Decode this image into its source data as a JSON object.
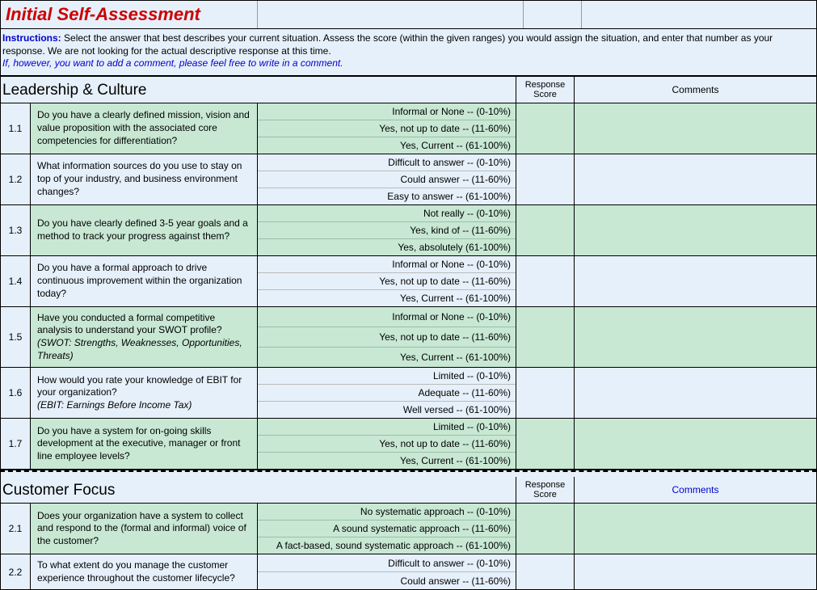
{
  "title": "Initial Self-Assessment",
  "instructions": {
    "lead": "Instructions:",
    "body": "Select the answer that best describes your current situation.  Assess the score (within the given ranges) you would assign the situation, and enter that number as your response.  We are not looking for the actual descriptive response at this time.",
    "comment_note": "If, however, you want to add a comment, please feel free to write in a comment."
  },
  "columns": {
    "score": "Response Score",
    "comments": "Comments"
  },
  "sections": [
    {
      "title": "Leadership & Culture",
      "comments_link": false,
      "questions": [
        {
          "num": "1.1",
          "text": "Do you have a clearly defined mission, vision and value proposition with the associated core competencies for differentiation?",
          "hint": "",
          "options": [
            "Informal or None -- (0-10%)",
            "Yes, not up to date -- (11-60%)",
            "Yes, Current -- (61-100%)"
          ],
          "shade": true
        },
        {
          "num": "1.2",
          "text": "What information sources do you use to stay on top of your industry, and business environment changes?",
          "hint": "",
          "options": [
            "Difficult to answer -- (0-10%)",
            "Could answer -- (11-60%)",
            "Easy to answer -- (61-100%)"
          ],
          "shade": false
        },
        {
          "num": "1.3",
          "text": "Do you have clearly defined 3-5 year goals and a method to track your progress against them?",
          "hint": "",
          "options": [
            "Not really -- (0-10%)",
            "Yes, kind of -- (11-60%)",
            "Yes, absolutely (61-100%)"
          ],
          "shade": true
        },
        {
          "num": "1.4",
          "text": "Do you have a formal approach to drive continuous improvement within the organization today?",
          "hint": "",
          "options": [
            "Informal or None -- (0-10%)",
            "Yes, not up to date -- (11-60%)",
            "Yes, Current -- (61-100%)"
          ],
          "shade": false
        },
        {
          "num": "1.5",
          "text": "Have you conducted a formal competitive analysis to understand your SWOT profile?",
          "hint": "(SWOT: Strengths, Weaknesses, Opportunities, Threats)",
          "options": [
            "Informal or None -- (0-10%)",
            "Yes, not up to date -- (11-60%)",
            "Yes, Current -- (61-100%)"
          ],
          "shade": true
        },
        {
          "num": "1.6",
          "text": "How would you rate  your knowledge of EBIT for your organization?",
          "hint": "(EBIT: Earnings Before Income Tax)",
          "options": [
            "Limited -- (0-10%)",
            "Adequate -- (11-60%)",
            "Well versed -- (61-100%)"
          ],
          "shade": false
        },
        {
          "num": "1.7",
          "text": "Do you have a system for on-going skills development at the executive, manager or front line employee levels?",
          "hint": "",
          "options": [
            "Limited -- (0-10%)",
            "Yes, not up to date -- (11-60%)",
            "Yes, Current -- (61-100%)"
          ],
          "shade": true
        }
      ]
    },
    {
      "title": "Customer Focus",
      "comments_link": true,
      "questions": [
        {
          "num": "2.1",
          "text": "Does your organization have a system to collect and respond to the (formal and informal) voice of the customer?",
          "hint": "",
          "options": [
            "No systematic approach -- (0-10%)",
            "A sound systematic approach -- (11-60%)",
            "A fact-based, sound systematic approach -- (61-100%)"
          ],
          "shade": true
        },
        {
          "num": "2.2",
          "text": "To what extent do you manage the customer experience throughout the customer lifecycle?",
          "hint": "",
          "options": [
            "Difficult to answer -- (0-10%)",
            "Could answer -- (11-60%)"
          ],
          "shade": false
        }
      ]
    }
  ]
}
